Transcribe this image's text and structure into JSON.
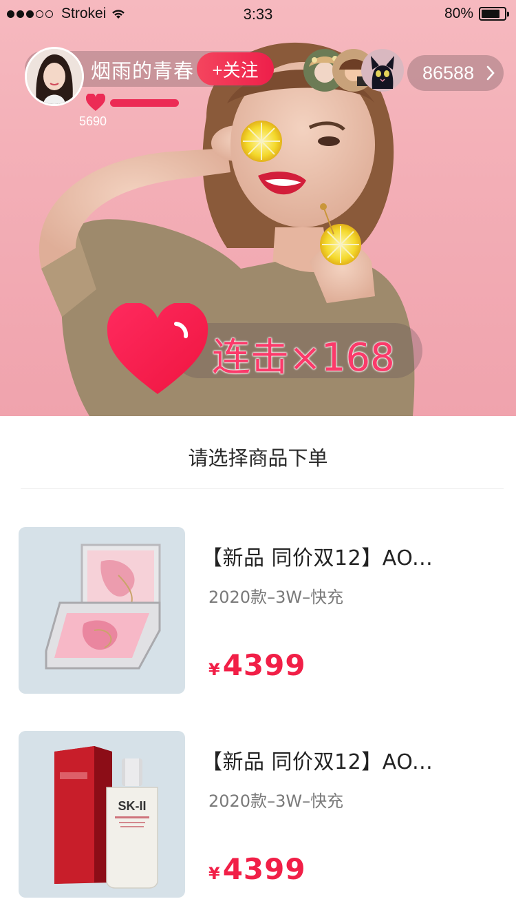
{
  "status_bar": {
    "carrier": "Strokei",
    "time": "3:33",
    "battery": "80%",
    "battery_level": 0.8
  },
  "host": {
    "name": "烟雨的青春",
    "follow_label": "+关注",
    "hot_count": "5690"
  },
  "viewers": {
    "count": "86588"
  },
  "combo": {
    "text": "连击×168"
  },
  "sheet": {
    "title": "请选择商品下单",
    "products": [
      {
        "title": "【新品 同价双12】AO...",
        "spec": "2020款–3W–快充",
        "currency": "¥",
        "price": "4399"
      },
      {
        "title": "【新品 同价双12】AO...",
        "spec": "2020款–3W–快充",
        "currency": "¥",
        "price": "4399"
      }
    ]
  },
  "colors": {
    "accent": "#f11f47",
    "hero_bg": "#f3aeb6",
    "thumb_bg": "#d6e1e8"
  }
}
